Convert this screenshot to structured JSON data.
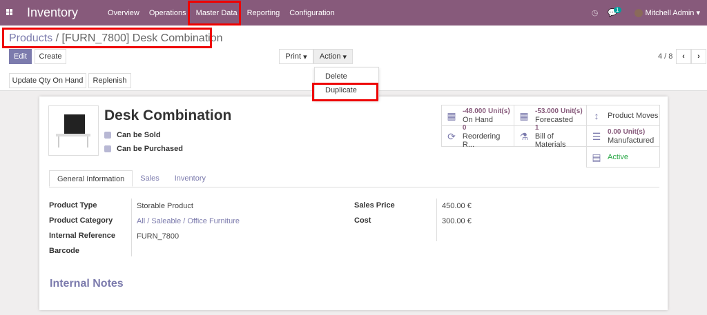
{
  "nav": {
    "app": "Inventory",
    "menu": [
      "Overview",
      "Operations",
      "Master Data",
      "Reporting",
      "Configuration"
    ],
    "messages_count": "1",
    "user": "Mitchell Admin"
  },
  "breadcrumb": {
    "parent": "Products",
    "sep": "/",
    "current": "[FURN_7800] Desk Combination"
  },
  "buttons": {
    "edit": "Edit",
    "create": "Create",
    "print": "Print",
    "action": "Action",
    "update_qty": "Update Qty On Hand",
    "replenish": "Replenish"
  },
  "pager": "4 / 8",
  "action_menu": [
    "Delete",
    "Duplicate"
  ],
  "product": {
    "name": "Desk Combination",
    "can_be_sold": "Can be Sold",
    "can_be_purchased": "Can be Purchased"
  },
  "stats": [
    {
      "value": "-48.000",
      "unit": "Unit(s)",
      "label": "On Hand",
      "icon": "building-icon"
    },
    {
      "value": "-53.000",
      "unit": "Unit(s)",
      "label": "Forecasted",
      "icon": "building-icon"
    },
    {
      "value": "",
      "unit": "",
      "label": "Product Moves",
      "icon": "arrows-v-icon"
    },
    {
      "value": "0",
      "unit": "",
      "label": "Reordering R...",
      "icon": "refresh-icon"
    },
    {
      "value": "1",
      "unit": "",
      "label": "Bill of Materials",
      "icon": "flask-icon"
    },
    {
      "value": "0.00",
      "unit": "Unit(s)",
      "label": "Manufactured",
      "icon": "list-icon"
    },
    {
      "value": "",
      "unit": "",
      "label": "Active",
      "icon": "archive-icon"
    }
  ],
  "tabs": [
    "General Information",
    "Sales",
    "Inventory"
  ],
  "fields": {
    "product_type_label": "Product Type",
    "product_type": "Storable Product",
    "category_label": "Product Category",
    "category": "All / Saleable / Office Furniture",
    "ref_label": "Internal Reference",
    "ref": "FURN_7800",
    "barcode_label": "Barcode",
    "sales_price_label": "Sales Price",
    "sales_price": "450.00 €",
    "cost_label": "Cost",
    "cost": "300.00 €"
  },
  "notes_title": "Internal Notes"
}
